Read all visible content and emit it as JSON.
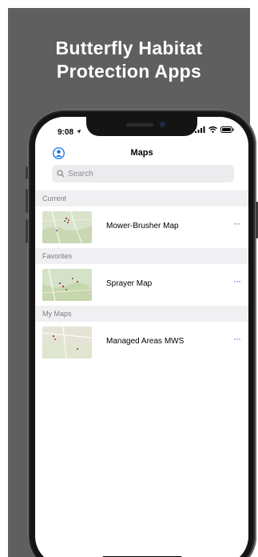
{
  "headline": {
    "line1": "Butterfly Habitat",
    "line2": "Protection Apps"
  },
  "status_bar": {
    "time": "9:08"
  },
  "nav": {
    "title": "Maps"
  },
  "search": {
    "placeholder": "Search"
  },
  "sections": [
    {
      "header": "Current",
      "maps": [
        {
          "name": "Mower-Brusher Map",
          "more": "···"
        }
      ]
    },
    {
      "header": "Favorites",
      "maps": [
        {
          "name": "Sprayer Map",
          "more": "···"
        }
      ]
    },
    {
      "header": "My Maps",
      "maps": [
        {
          "name": "Managed Areas MWS",
          "more": "···"
        }
      ]
    }
  ],
  "colors": {
    "banner": "#5f5f5f",
    "accent": "#1a73e8",
    "section_bg": "#f0f0f2"
  },
  "icons": [
    "location-arrow-icon",
    "signal-icon",
    "wifi-icon",
    "battery-icon",
    "profile-icon",
    "search-icon",
    "more-icon"
  ]
}
